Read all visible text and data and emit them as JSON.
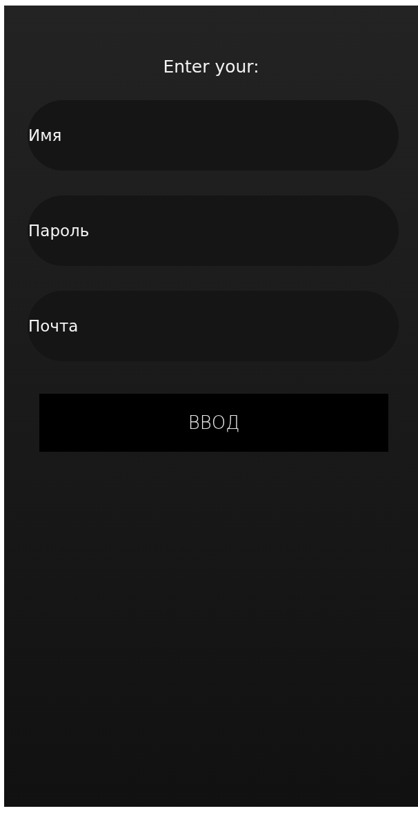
{
  "title": "Enter your:",
  "fields": [
    {
      "placeholder": "Имя"
    },
    {
      "placeholder": "Пароль"
    },
    {
      "placeholder": "Почта"
    }
  ],
  "button": {
    "label": "ВВОД"
  }
}
